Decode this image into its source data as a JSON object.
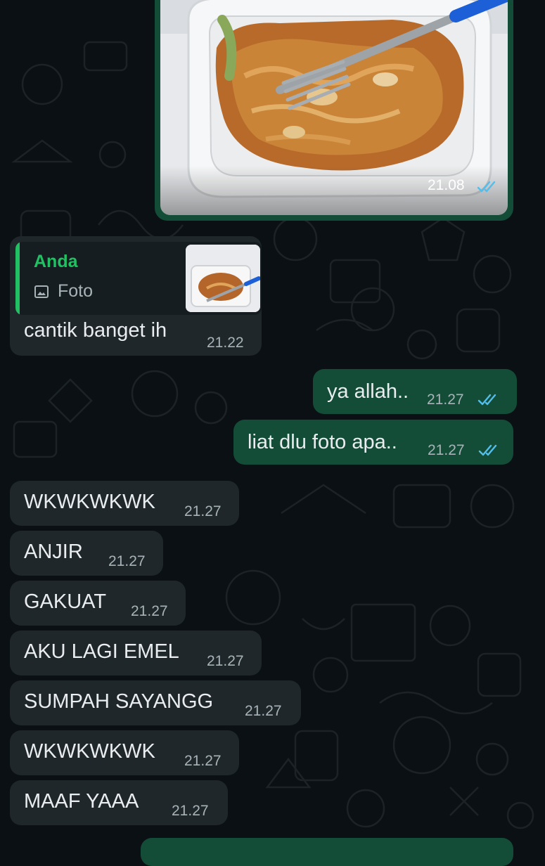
{
  "colors": {
    "background": "#0b1014",
    "incoming_bubble": "#1f272a",
    "outgoing_bubble": "#144d37",
    "read_ticks": "#53bdeb",
    "quote_accent": "#21c063"
  },
  "image_message": {
    "type": "photo",
    "time": "21.08",
    "status": "read"
  },
  "reply_message": {
    "quoted_author": "Anda",
    "quoted_icon": "photo-icon",
    "quoted_type": "Foto",
    "text": "cantik banget ih",
    "time": "21.22"
  },
  "messages": [
    {
      "direction": "outgoing",
      "text": "ya allah..",
      "time": "21.27",
      "status": "read"
    },
    {
      "direction": "outgoing",
      "text": "liat dlu foto apa..",
      "time": "21.27",
      "status": "read"
    },
    {
      "direction": "incoming",
      "text": "WKWKWKWK",
      "time": "21.27"
    },
    {
      "direction": "incoming",
      "text": "ANJIR",
      "time": "21.27"
    },
    {
      "direction": "incoming",
      "text": "GAKUAT",
      "time": "21.27"
    },
    {
      "direction": "incoming",
      "text": "AKU LAGI EMEL",
      "time": "21.27"
    },
    {
      "direction": "incoming",
      "text": "SUMPAH SAYANGG",
      "time": "21.27"
    },
    {
      "direction": "incoming",
      "text": "WKWKWKWK",
      "time": "21.27"
    },
    {
      "direction": "incoming",
      "text": "MAAF YAAA",
      "time": "21.27"
    }
  ]
}
